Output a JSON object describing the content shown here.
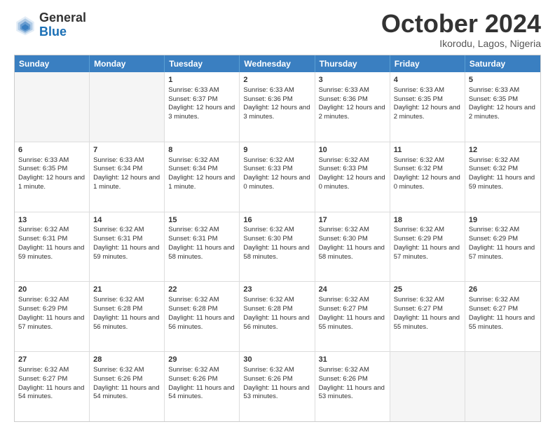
{
  "header": {
    "logo_general": "General",
    "logo_blue": "Blue",
    "month_title": "October 2024",
    "location": "Ikorodu, Lagos, Nigeria"
  },
  "weekdays": [
    "Sunday",
    "Monday",
    "Tuesday",
    "Wednesday",
    "Thursday",
    "Friday",
    "Saturday"
  ],
  "rows": [
    [
      {
        "day": "",
        "sunrise": "",
        "sunset": "",
        "daylight": ""
      },
      {
        "day": "",
        "sunrise": "",
        "sunset": "",
        "daylight": ""
      },
      {
        "day": "1",
        "sunrise": "Sunrise: 6:33 AM",
        "sunset": "Sunset: 6:37 PM",
        "daylight": "Daylight: 12 hours and 3 minutes."
      },
      {
        "day": "2",
        "sunrise": "Sunrise: 6:33 AM",
        "sunset": "Sunset: 6:36 PM",
        "daylight": "Daylight: 12 hours and 3 minutes."
      },
      {
        "day": "3",
        "sunrise": "Sunrise: 6:33 AM",
        "sunset": "Sunset: 6:36 PM",
        "daylight": "Daylight: 12 hours and 2 minutes."
      },
      {
        "day": "4",
        "sunrise": "Sunrise: 6:33 AM",
        "sunset": "Sunset: 6:35 PM",
        "daylight": "Daylight: 12 hours and 2 minutes."
      },
      {
        "day": "5",
        "sunrise": "Sunrise: 6:33 AM",
        "sunset": "Sunset: 6:35 PM",
        "daylight": "Daylight: 12 hours and 2 minutes."
      }
    ],
    [
      {
        "day": "6",
        "sunrise": "Sunrise: 6:33 AM",
        "sunset": "Sunset: 6:35 PM",
        "daylight": "Daylight: 12 hours and 1 minute."
      },
      {
        "day": "7",
        "sunrise": "Sunrise: 6:33 AM",
        "sunset": "Sunset: 6:34 PM",
        "daylight": "Daylight: 12 hours and 1 minute."
      },
      {
        "day": "8",
        "sunrise": "Sunrise: 6:32 AM",
        "sunset": "Sunset: 6:34 PM",
        "daylight": "Daylight: 12 hours and 1 minute."
      },
      {
        "day": "9",
        "sunrise": "Sunrise: 6:32 AM",
        "sunset": "Sunset: 6:33 PM",
        "daylight": "Daylight: 12 hours and 0 minutes."
      },
      {
        "day": "10",
        "sunrise": "Sunrise: 6:32 AM",
        "sunset": "Sunset: 6:33 PM",
        "daylight": "Daylight: 12 hours and 0 minutes."
      },
      {
        "day": "11",
        "sunrise": "Sunrise: 6:32 AM",
        "sunset": "Sunset: 6:32 PM",
        "daylight": "Daylight: 12 hours and 0 minutes."
      },
      {
        "day": "12",
        "sunrise": "Sunrise: 6:32 AM",
        "sunset": "Sunset: 6:32 PM",
        "daylight": "Daylight: 11 hours and 59 minutes."
      }
    ],
    [
      {
        "day": "13",
        "sunrise": "Sunrise: 6:32 AM",
        "sunset": "Sunset: 6:31 PM",
        "daylight": "Daylight: 11 hours and 59 minutes."
      },
      {
        "day": "14",
        "sunrise": "Sunrise: 6:32 AM",
        "sunset": "Sunset: 6:31 PM",
        "daylight": "Daylight: 11 hours and 59 minutes."
      },
      {
        "day": "15",
        "sunrise": "Sunrise: 6:32 AM",
        "sunset": "Sunset: 6:31 PM",
        "daylight": "Daylight: 11 hours and 58 minutes."
      },
      {
        "day": "16",
        "sunrise": "Sunrise: 6:32 AM",
        "sunset": "Sunset: 6:30 PM",
        "daylight": "Daylight: 11 hours and 58 minutes."
      },
      {
        "day": "17",
        "sunrise": "Sunrise: 6:32 AM",
        "sunset": "Sunset: 6:30 PM",
        "daylight": "Daylight: 11 hours and 58 minutes."
      },
      {
        "day": "18",
        "sunrise": "Sunrise: 6:32 AM",
        "sunset": "Sunset: 6:29 PM",
        "daylight": "Daylight: 11 hours and 57 minutes."
      },
      {
        "day": "19",
        "sunrise": "Sunrise: 6:32 AM",
        "sunset": "Sunset: 6:29 PM",
        "daylight": "Daylight: 11 hours and 57 minutes."
      }
    ],
    [
      {
        "day": "20",
        "sunrise": "Sunrise: 6:32 AM",
        "sunset": "Sunset: 6:29 PM",
        "daylight": "Daylight: 11 hours and 57 minutes."
      },
      {
        "day": "21",
        "sunrise": "Sunrise: 6:32 AM",
        "sunset": "Sunset: 6:28 PM",
        "daylight": "Daylight: 11 hours and 56 minutes."
      },
      {
        "day": "22",
        "sunrise": "Sunrise: 6:32 AM",
        "sunset": "Sunset: 6:28 PM",
        "daylight": "Daylight: 11 hours and 56 minutes."
      },
      {
        "day": "23",
        "sunrise": "Sunrise: 6:32 AM",
        "sunset": "Sunset: 6:28 PM",
        "daylight": "Daylight: 11 hours and 56 minutes."
      },
      {
        "day": "24",
        "sunrise": "Sunrise: 6:32 AM",
        "sunset": "Sunset: 6:27 PM",
        "daylight": "Daylight: 11 hours and 55 minutes."
      },
      {
        "day": "25",
        "sunrise": "Sunrise: 6:32 AM",
        "sunset": "Sunset: 6:27 PM",
        "daylight": "Daylight: 11 hours and 55 minutes."
      },
      {
        "day": "26",
        "sunrise": "Sunrise: 6:32 AM",
        "sunset": "Sunset: 6:27 PM",
        "daylight": "Daylight: 11 hours and 55 minutes."
      }
    ],
    [
      {
        "day": "27",
        "sunrise": "Sunrise: 6:32 AM",
        "sunset": "Sunset: 6:27 PM",
        "daylight": "Daylight: 11 hours and 54 minutes."
      },
      {
        "day": "28",
        "sunrise": "Sunrise: 6:32 AM",
        "sunset": "Sunset: 6:26 PM",
        "daylight": "Daylight: 11 hours and 54 minutes."
      },
      {
        "day": "29",
        "sunrise": "Sunrise: 6:32 AM",
        "sunset": "Sunset: 6:26 PM",
        "daylight": "Daylight: 11 hours and 54 minutes."
      },
      {
        "day": "30",
        "sunrise": "Sunrise: 6:32 AM",
        "sunset": "Sunset: 6:26 PM",
        "daylight": "Daylight: 11 hours and 53 minutes."
      },
      {
        "day": "31",
        "sunrise": "Sunrise: 6:32 AM",
        "sunset": "Sunset: 6:26 PM",
        "daylight": "Daylight: 11 hours and 53 minutes."
      },
      {
        "day": "",
        "sunrise": "",
        "sunset": "",
        "daylight": ""
      },
      {
        "day": "",
        "sunrise": "",
        "sunset": "",
        "daylight": ""
      }
    ]
  ]
}
